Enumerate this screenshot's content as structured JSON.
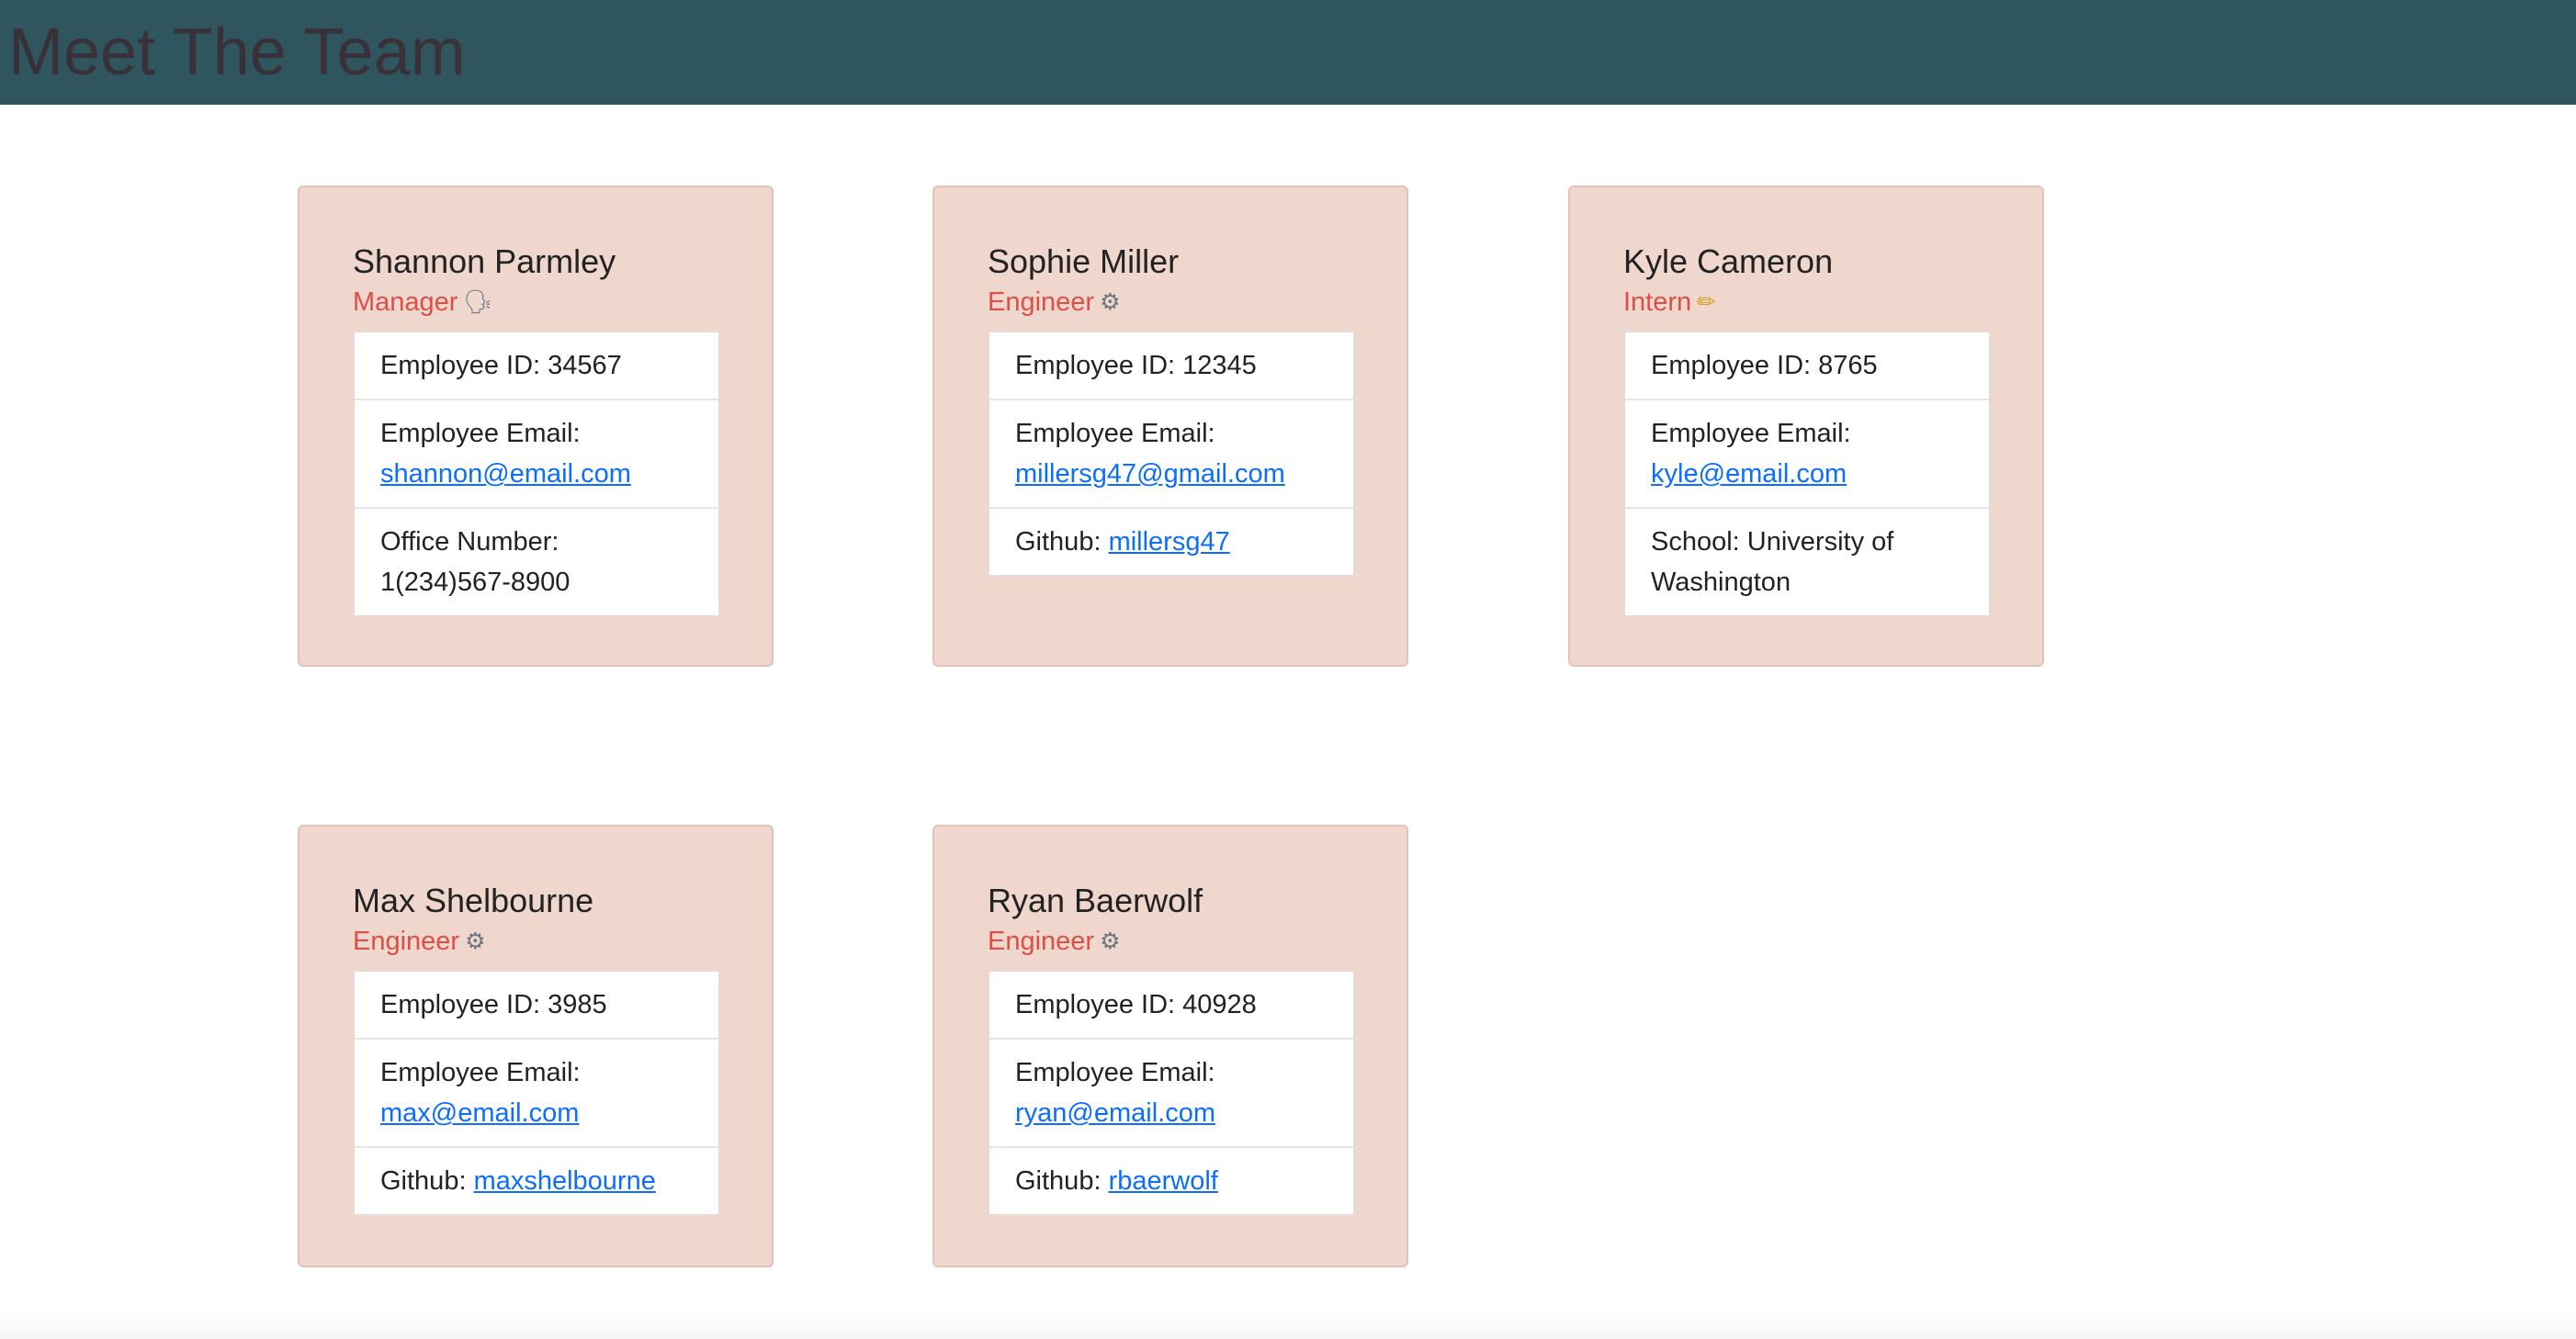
{
  "header": {
    "title": "Meet The Team",
    "background_color": "#2f565e",
    "title_color": "#3a3038"
  },
  "colors": {
    "card_background": "#efd7cd",
    "role_text": "#dd4f47",
    "link": "#0d6efd"
  },
  "employees": [
    {
      "name": "Shannon Parmley",
      "role": "Manager",
      "role_icon": "speaking-head-icon",
      "role_icon_glyph": "🗣",
      "id_label": "Employee ID: 34567",
      "email_label": "Employee Email:",
      "email": "shannon@email.com",
      "extra_label": "Office Number:",
      "extra_value": "1(234)567-8900"
    },
    {
      "name": "Sophie Miller",
      "role": "Engineer",
      "role_icon": "gear-icon",
      "role_icon_glyph": "⚙",
      "id_label": "Employee ID: 12345",
      "email_label": "Employee Email:",
      "email": "millersg47@gmail.com",
      "extra_label": "Github:",
      "extra_value": "millersg47"
    },
    {
      "name": "Kyle Cameron",
      "role": "Intern",
      "role_icon": "pencil-icon",
      "role_icon_glyph": "✏",
      "id_label": "Employee ID: 8765",
      "email_label": "Employee Email:",
      "email": "kyle@email.com",
      "extra_label": "School:",
      "extra_value": "University of Washington"
    },
    {
      "name": "Max Shelbourne",
      "role": "Engineer",
      "role_icon": "gear-icon",
      "role_icon_glyph": "⚙",
      "id_label": "Employee ID: 3985",
      "email_label": "Employee Email:",
      "email": "max@email.com",
      "extra_label": "Github:",
      "extra_value": "maxshelbourne"
    },
    {
      "name": "Ryan Baerwolf",
      "role": "Engineer",
      "role_icon": "gear-icon",
      "role_icon_glyph": "⚙",
      "id_label": "Employee ID: 40928",
      "email_label": "Employee Email:",
      "email": "ryan@email.com",
      "extra_label": "Github:",
      "extra_value": "rbaerwolf"
    }
  ]
}
